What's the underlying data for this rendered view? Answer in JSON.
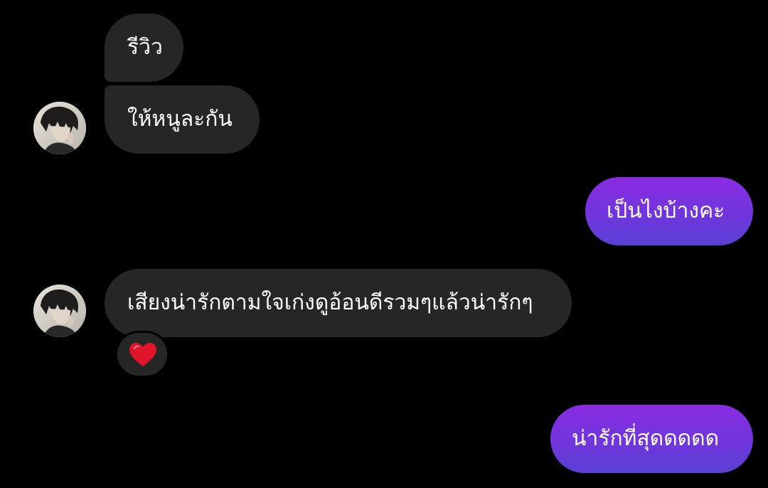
{
  "thread": {
    "messages": [
      {
        "sender": "other",
        "text": "รีวิว"
      },
      {
        "sender": "other",
        "text": "ให้หนูละกัน"
      },
      {
        "sender": "me",
        "text": "เป็นไงบ้างคะ"
      },
      {
        "sender": "other",
        "text": "เสียงน่ารักตามใจเก่งดูอ้อนดีรวมๆแล้วน่ารักๆ",
        "reaction": "heart"
      },
      {
        "sender": "me",
        "text": "น่ารักที่สุดดดดด"
      }
    ]
  },
  "colors": {
    "background": "#000000",
    "incoming_bubble": "#262626",
    "outgoing_gradient_top": "#8a2be2",
    "outgoing_gradient_bottom": "#5b3fd6",
    "reaction_heart": "#e0142b"
  },
  "icons": {
    "avatar": "avatar",
    "reaction": "heart-icon"
  }
}
